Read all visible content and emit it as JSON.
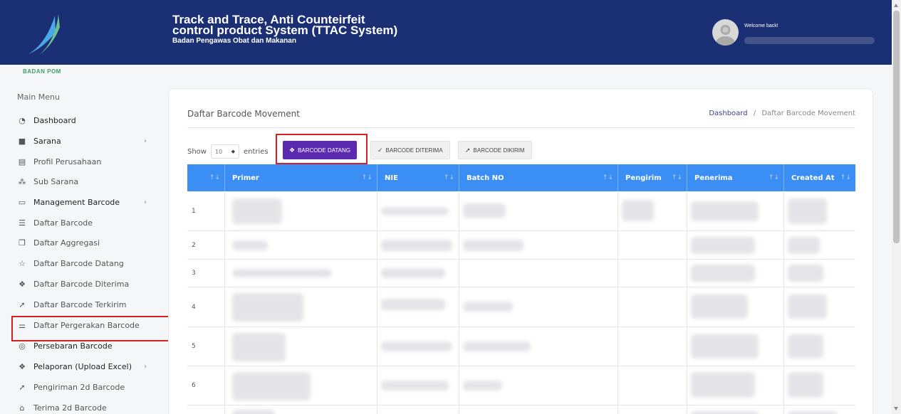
{
  "header": {
    "logo_text": "BADAN POM",
    "title_line1": "Track and Trace, Anti Counteirfeit",
    "title_line2": "control product System (TTAC System)",
    "subtitle": "Badan Pengawas Obat dan Makanan",
    "welcome": "Welcome back!"
  },
  "sidebar": {
    "title": "Main Menu",
    "items": [
      {
        "label": "Dashboard",
        "icon": "gauge-icon"
      },
      {
        "label": "Sarana",
        "icon": "house-icon",
        "chevron": "›"
      },
      {
        "label": "Profil Perusahaan",
        "icon": "building-icon"
      },
      {
        "label": "Sub Sarana",
        "icon": "nodes-icon"
      },
      {
        "label": "Management Barcode",
        "icon": "calendar-icon",
        "chevron": "›"
      },
      {
        "label": "Daftar Barcode",
        "icon": "list-icon"
      },
      {
        "label": "Daftar Aggregasi",
        "icon": "stack-icon"
      },
      {
        "label": "Daftar Barcode Datang",
        "icon": "star-icon"
      },
      {
        "label": "Daftar Barcode Diterima",
        "icon": "gift-icon"
      },
      {
        "label": "Daftar Barcode Terkirim",
        "icon": "send-icon"
      },
      {
        "label": "Daftar Pergerakan Barcode",
        "icon": "sliders-icon"
      },
      {
        "label": "Persebaran Barcode",
        "icon": "pin-icon"
      },
      {
        "label": "Pelaporan (Upload Excel)",
        "icon": "gift-icon",
        "chevron": "›"
      },
      {
        "label": "Pengiriman 2d Barcode",
        "icon": "send-icon"
      },
      {
        "label": "Terima 2d Barcode",
        "icon": "tag-icon"
      }
    ]
  },
  "card": {
    "title": "Daftar Barcode Movement",
    "breadcrumb_link": "Dashboard",
    "breadcrumb_sep": "/",
    "breadcrumb_current": "Daftar Barcode Movement",
    "show_label": "Show",
    "entries_value": "10",
    "entries_label": "entries",
    "btn_datang": "BARCODE DATANG",
    "btn_diterima": "BARCODE DITERIMA",
    "btn_dikirim": "BARCODE DIKIRIM"
  },
  "table": {
    "columns": [
      "",
      "Primer",
      "NIE",
      "Batch NO",
      "Pengirim",
      "Penerima",
      "Created At"
    ],
    "rows": [
      "1",
      "2",
      "3",
      "4",
      "5",
      "6"
    ]
  }
}
